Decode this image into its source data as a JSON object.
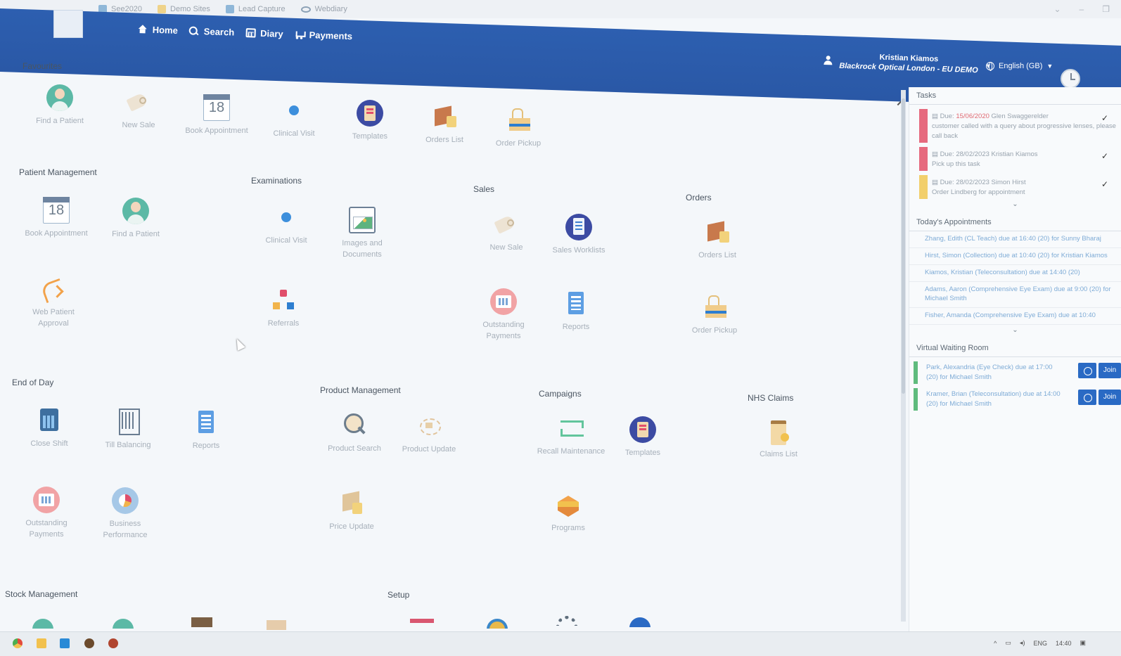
{
  "browser": {
    "bookmarks": [
      "See2020",
      "Demo Sites",
      "Lead Capture",
      "Webdiary"
    ]
  },
  "header": {
    "nav": [
      {
        "label": "Home",
        "icon": "home-icon"
      },
      {
        "label": "Search",
        "icon": "search-icon"
      },
      {
        "label": "Diary",
        "icon": "calendar-icon"
      },
      {
        "label": "Payments",
        "icon": "cart-icon"
      }
    ],
    "user_name": "Kristian Kiamos",
    "organisation": "Blackrock Optical London - EU DEMO",
    "language": "English (GB)"
  },
  "sections": {
    "favourites": "Favourites",
    "patient_management": "Patient Management",
    "examinations": "Examinations",
    "sales": "Sales",
    "orders": "Orders",
    "end_of_day": "End of Day",
    "product_management": "Product Management",
    "campaigns": "Campaigns",
    "nhs_claims": "NHS Claims",
    "stock_management": "Stock Management",
    "setup": "Setup"
  },
  "tiles": {
    "fav_find_patient": "Find a Patient",
    "fav_new_sale": "New Sale",
    "fav_book_appointment": "Book Appointment",
    "fav_clinical_visit": "Clinical Visit",
    "fav_templates": "Templates",
    "fav_orders_list": "Orders List",
    "fav_order_pickup": "Order Pickup",
    "pm_book_appointment": "Book Appointment",
    "pm_find_patient": "Find a Patient",
    "pm_web_patient_approval": "Web Patient Approval",
    "ex_clinical_visit": "Clinical Visit",
    "ex_images_documents": "Images and Documents",
    "ex_referrals": "Referrals",
    "sa_new_sale": "New Sale",
    "sa_sales_worklists": "Sales Worklists",
    "sa_outstanding_payments": "Outstanding Payments",
    "sa_reports": "Reports",
    "or_orders_list": "Orders List",
    "or_order_pickup": "Order Pickup",
    "eod_close_shift": "Close Shift",
    "eod_till_balancing": "Till Balancing",
    "eod_reports": "Reports",
    "eod_outstanding_payments": "Outstanding Payments",
    "eod_business_performance": "Business Performance",
    "prod_search": "Product Search",
    "prod_update": "Product Update",
    "prod_price_update": "Price Update",
    "camp_recall": "Recall Maintenance",
    "camp_templates": "Templates",
    "camp_programs": "Programs",
    "nhs_claims_list": "Claims List",
    "calendar_day": "18"
  },
  "tasks_panel": {
    "title": "Tasks",
    "tasks": [
      {
        "due": "Due:",
        "date": "15/06/2020",
        "person": "Glen Swaggerelder",
        "note": "customer called with a query about progressive lenses, please call back",
        "color": "#e66a7e"
      },
      {
        "due": "Due:",
        "date": "28/02/2023",
        "person": "Kristian Kiamos",
        "note": "Pick up this task",
        "color": "#e66a7e"
      },
      {
        "due": "Due:",
        "date": "28/02/2023",
        "person": "Simon Hirst",
        "note": "Order Lindberg for appointment",
        "color": "#f2cf6b"
      }
    ]
  },
  "appointments_panel": {
    "title": "Today's Appointments",
    "items": [
      "Zhang, Edith (CL Teach) due at 16:40 (20) for Sunny Bharaj",
      "Hirst, Simon (Collection) due at 10:40 (20) for Kristian Kiamos",
      "Kiamos, Kristian (Teleconsultation) due at 14:40 (20)",
      "Adams, Aaron (Comprehensive Eye Exam) due at 9:00 (20) for Michael Smith",
      "Fisher, Amanda (Comprehensive Eye Exam) due at 10:40"
    ]
  },
  "waiting_room": {
    "title": "Virtual Waiting Room",
    "join_label": "Join",
    "items": [
      "Park, Alexandria (Eye Check) due at 17:00 (20) for Michael Smith",
      "Kramer, Brian (Teleconsultation) due at 14:00 (20) for Michael Smith"
    ]
  },
  "taskbar": {
    "lang": "ENG",
    "time": "14:40"
  }
}
